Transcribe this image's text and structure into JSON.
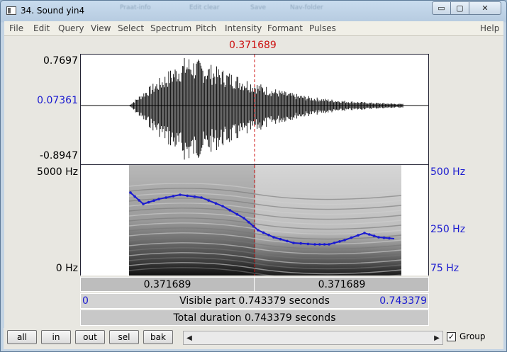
{
  "window": {
    "title": "34. Sound yin4",
    "ghost_text": [
      "Praat-info",
      "Edit clear",
      "Save",
      "Nav-folder"
    ]
  },
  "controls": {
    "minimize_icon": "▭",
    "maximize_icon": "▢",
    "close_icon": "✕"
  },
  "menu": [
    "File",
    "Edit",
    "Query",
    "View",
    "Select",
    "Spectrum",
    "Pitch",
    "Intensity",
    "Formant",
    "Pulses",
    "Help"
  ],
  "cursor": {
    "time_label": "0.371689",
    "time": 0.371689
  },
  "waveform": {
    "y_max": "0.7697",
    "y_cursor": "0.07361",
    "y_min": "-0.8947"
  },
  "spectrogram": {
    "freq_top": "5000 Hz",
    "freq_bottom": "0 Hz"
  },
  "pitch_axis": {
    "top": "500 Hz",
    "mid": "250 Hz",
    "bottom": "75 Hz"
  },
  "selection_bar": {
    "left": "0.371689",
    "right": "0.371689"
  },
  "visible_bar": {
    "start": "0",
    "label": "Visible part 0.743379 seconds",
    "end": "0.743379"
  },
  "total_bar": {
    "label": "Total duration 0.743379 seconds"
  },
  "buttons": {
    "all": "all",
    "in": "in",
    "out": "out",
    "sel": "sel",
    "bak": "bak"
  },
  "scrollbar": {
    "left_arrow": "◀",
    "right_arrow": "▶"
  },
  "group": {
    "label": "Group",
    "checked": true,
    "check_glyph": "✓"
  },
  "colors": {
    "cursor": "#cc1111",
    "pitch": "#1a1ad0",
    "axis_label_blue": "#1a1ad0"
  }
}
